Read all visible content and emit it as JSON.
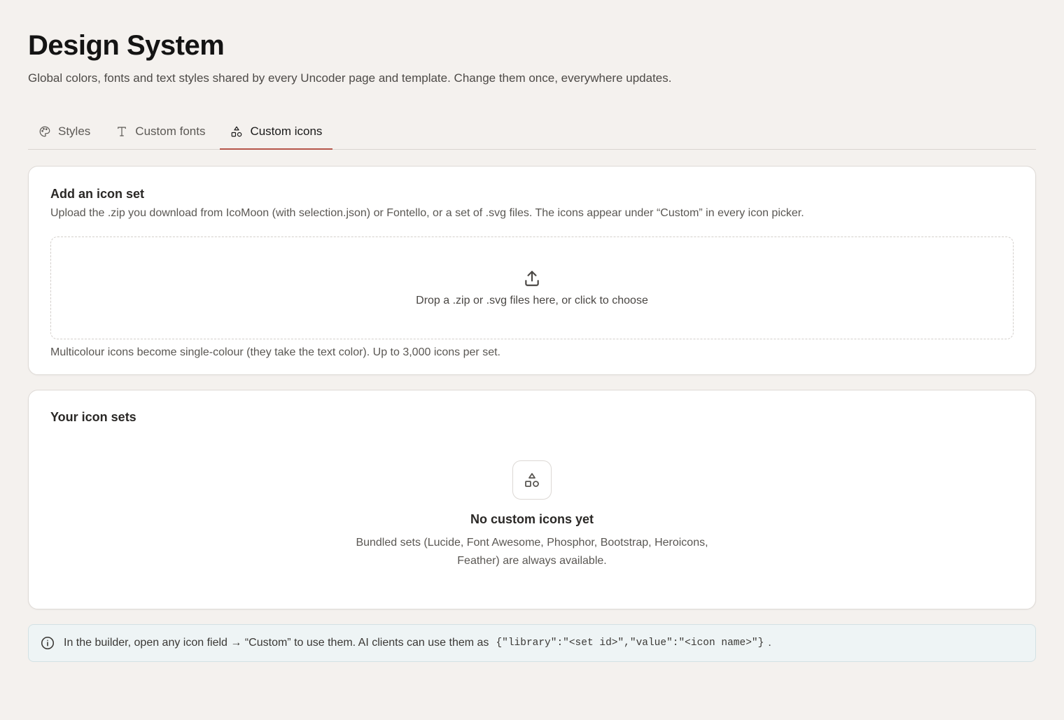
{
  "header": {
    "title": "Design System",
    "subtitle": "Global colors, fonts and text styles shared by every Uncoder page and template. Change them once, everywhere updates."
  },
  "tabs": [
    {
      "label": "Styles",
      "icon": "palette-icon",
      "active": false
    },
    {
      "label": "Custom fonts",
      "icon": "type-icon",
      "active": false
    },
    {
      "label": "Custom icons",
      "icon": "shapes-icon",
      "active": true
    }
  ],
  "add_set": {
    "title": "Add an icon set",
    "description": "Upload the .zip you download from IcoMoon (with selection.json) or Fontello, or a set of .svg files. The icons appear under “Custom” in every icon picker.",
    "dropzone_label": "Drop a .zip or .svg files here, or click to choose",
    "note": "Multicolour icons become single-colour (they take the text color). Up to 3,000 icons per set."
  },
  "your_sets": {
    "title": "Your icon sets",
    "empty_title": "No custom icons yet",
    "empty_description": "Bundled sets (Lucide, Font Awesome, Phosphor, Bootstrap, Heroicons, Feather) are always available."
  },
  "info": {
    "text": "In the builder, open any icon field → “Custom” to use them. AI clients can use them as",
    "code": "{\"library\":\"<set id>\",\"value\":\"<icon name>\"}",
    "suffix": "."
  },
  "colors": {
    "background": "#f4f1ee",
    "active_tab_underline": "#b5564a",
    "info_background": "#eef4f5"
  }
}
